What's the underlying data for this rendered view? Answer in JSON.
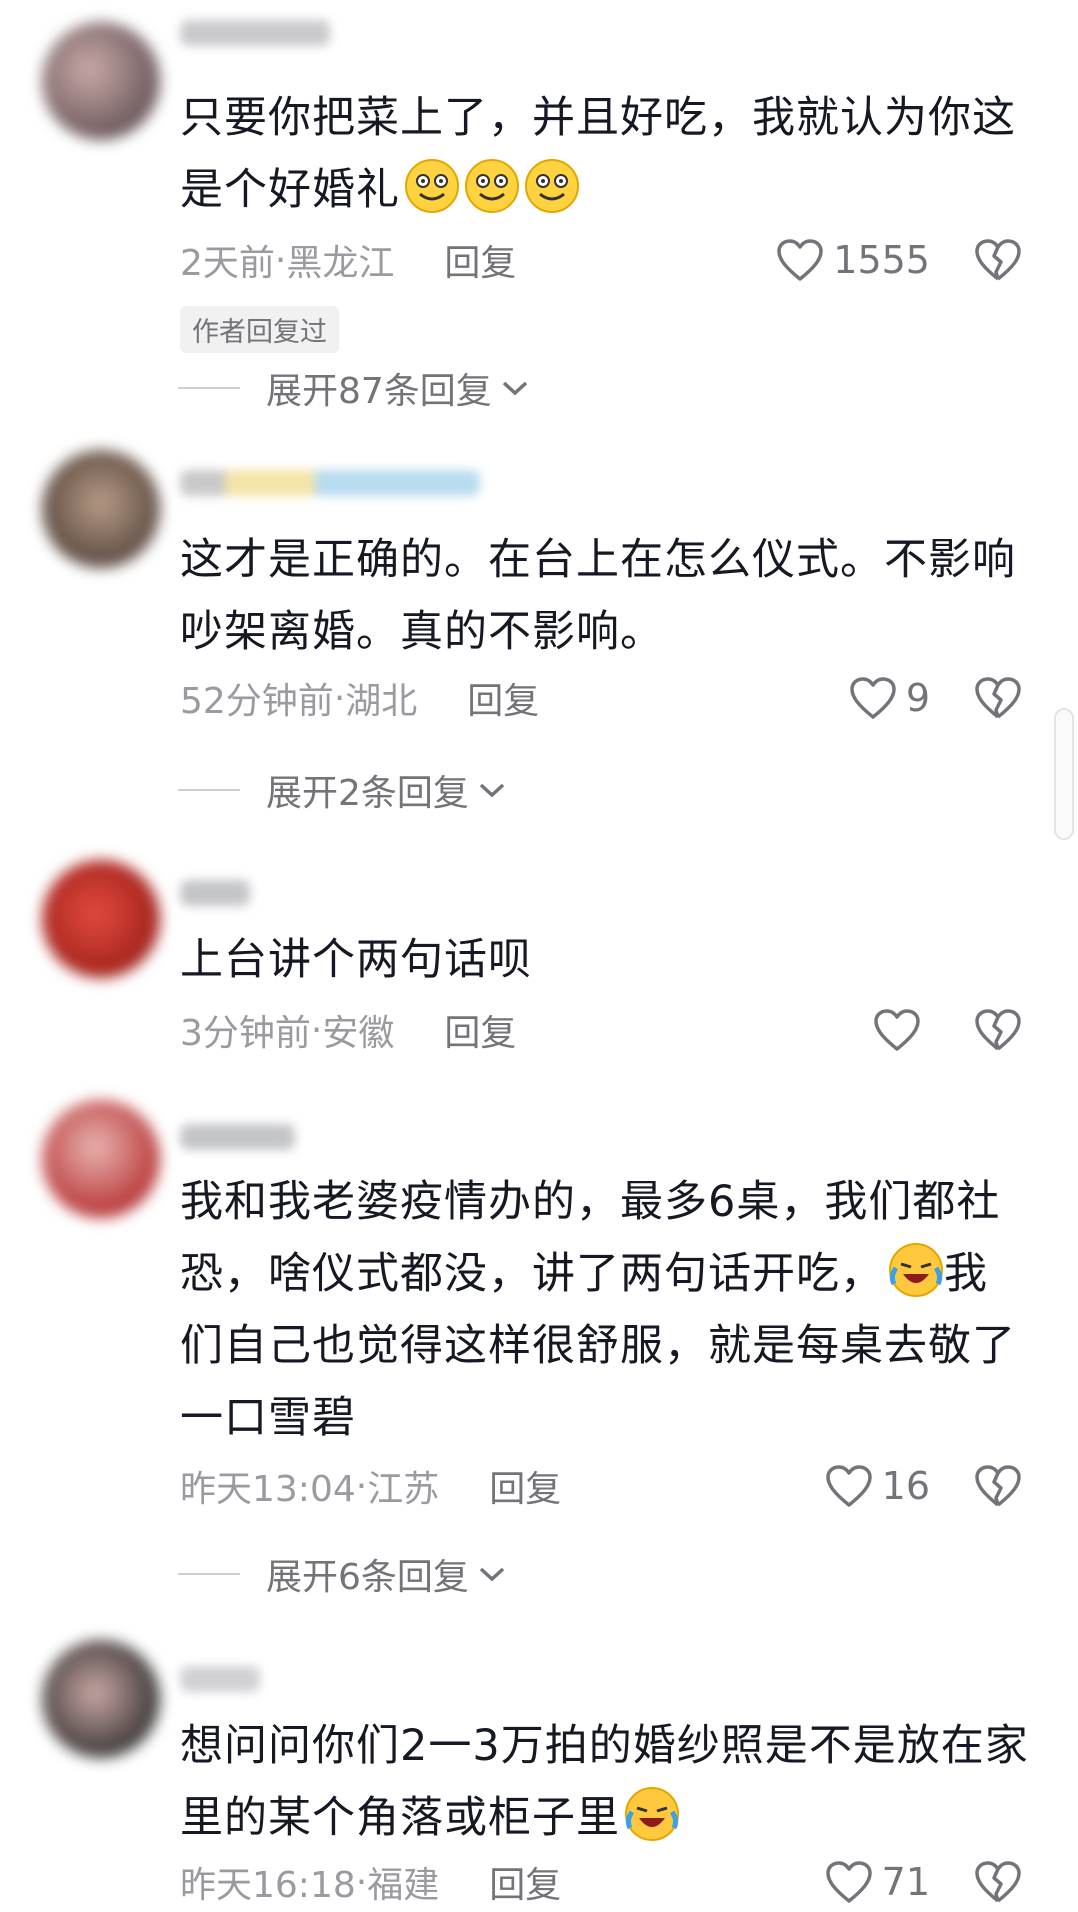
{
  "comments": [
    {
      "text_before": "只要你把菜上了，并且好吃，我就认为你这是个好婚礼",
      "time": "2天前",
      "location": "黑龙江",
      "reply_label": "回复",
      "likes": "1555",
      "badge": "作者回复过",
      "expand": "展开87条回复"
    },
    {
      "text_before": "这才是正确的。在台上在怎么仪式。不影响吵架离婚。真的不影响。",
      "time": "52分钟前",
      "location": "湖北",
      "reply_label": "回复",
      "likes": "9",
      "expand": "展开2条回复"
    },
    {
      "text_before": "上台讲个两句话呗",
      "time": "3分钟前",
      "location": "安徽",
      "reply_label": "回复",
      "likes": ""
    },
    {
      "text_before": "我和我老婆疫情办的，最多6桌，我们都社恐，啥仪式都没，讲了两句话开吃，",
      "text_after": "我们自己也觉得这样很舒服，就是每桌去敬了一口雪碧",
      "time": "昨天13:04",
      "location": "江苏",
      "reply_label": "回复",
      "likes": "16",
      "expand": "展开6条回复"
    },
    {
      "text_before": "想问问你们2一3万拍的婚纱照是不是放在家里的某个角落或柜子里",
      "time": "昨天16:18",
      "location": "福建",
      "reply_label": "回复",
      "likes": "71"
    }
  ],
  "separator": " · ",
  "colors": {
    "text": "#161823",
    "meta": "#9a9ba1",
    "secondary": "#737479"
  },
  "icons": [
    "heart-outline-icon",
    "broken-heart-icon",
    "chevron-down-icon",
    "smile-emoji-icon",
    "laugh-cry-emoji-icon"
  ]
}
